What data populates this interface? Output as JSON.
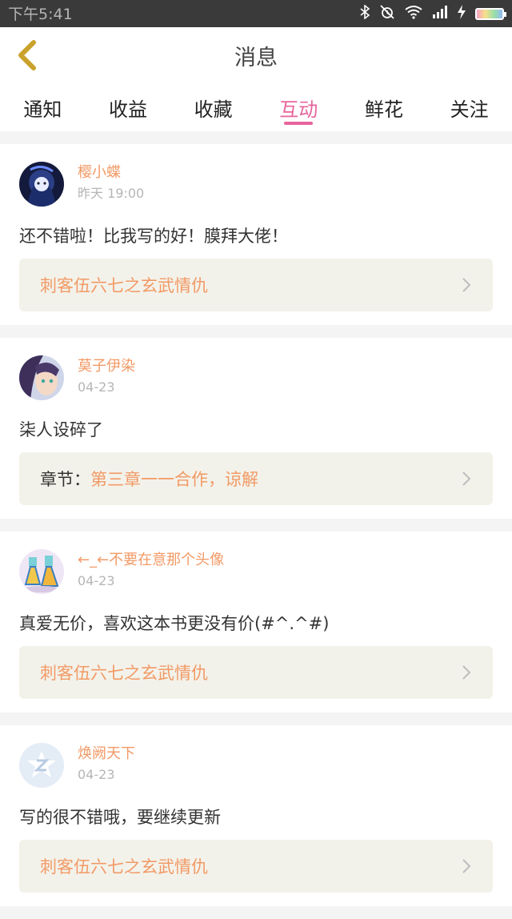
{
  "status_bar": {
    "time": "下午5:41",
    "icons": [
      "bluetooth-icon",
      "alarm-off-icon",
      "wifi-icon",
      "signal-icon",
      "charging-icon",
      "battery-icon"
    ]
  },
  "nav": {
    "title": "消息",
    "back_icon": "chevron-left-icon",
    "accent_color": "#e7649c"
  },
  "tabs": [
    {
      "label": "通知",
      "active": false
    },
    {
      "label": "收益",
      "active": false
    },
    {
      "label": "收藏",
      "active": false
    },
    {
      "label": "互动",
      "active": true
    },
    {
      "label": "鲜花",
      "active": false
    },
    {
      "label": "关注",
      "active": false
    }
  ],
  "messages": [
    {
      "username": "樱小蝶",
      "time": "昨天 19:00",
      "comment": "还不错啦！比我写的好！膜拜大佬！",
      "link_prefix": "",
      "link_text": "刺客伍六七之玄武情仇"
    },
    {
      "username": "莫子伊染",
      "time": "04-23",
      "comment": "柒人设碎了",
      "link_prefix": "章节：",
      "link_text": "第三章一一合作，谅解"
    },
    {
      "username": "←_←不要在意那个头像",
      "time": "04-23",
      "comment": "真爱无价，喜欢这本书更没有价(#^.^#)",
      "link_prefix": "",
      "link_text": "刺客伍六七之玄武情仇"
    },
    {
      "username": "焕阙天下",
      "time": "04-23",
      "comment": "写的很不错哦，要继续更新",
      "link_prefix": "",
      "link_text": "刺客伍六七之玄武情仇"
    }
  ],
  "colors": {
    "username": "#f29a66",
    "link_box_bg": "#f3f2ea",
    "timestamp": "#b5b5b5"
  }
}
